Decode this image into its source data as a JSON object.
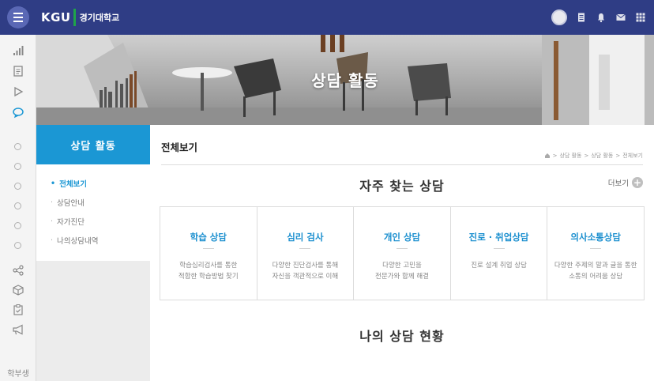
{
  "topbar": {
    "logo_text": "KGU",
    "university_name": "경기대학교",
    "icons": [
      "profile-avatar",
      "document-icon",
      "bell-icon",
      "mail-icon",
      "grid-icon"
    ]
  },
  "rail": {
    "icons": [
      "signal-icon",
      "document-icon",
      "play-icon",
      "chat-icon",
      "circle",
      "circle",
      "circle",
      "circle",
      "circle",
      "circle",
      "share-icon",
      "cube-icon",
      "clipboard-icon",
      "megaphone-icon"
    ],
    "bottom_label": "학부생"
  },
  "hero": {
    "title": "상담 활동"
  },
  "sidemenu": {
    "title": "상담 활동",
    "items": [
      {
        "label": "전체보기",
        "active": true
      },
      {
        "label": "상담안내",
        "active": false
      },
      {
        "label": "자가진단",
        "active": false
      },
      {
        "label": "나의상담내역",
        "active": false
      }
    ]
  },
  "content": {
    "page_title": "전체보기",
    "breadcrumb": [
      "상담 활동",
      "상담 활동",
      "전체보기"
    ],
    "frequent_section_title": "자주 찾는 상담",
    "more_label": "더보기",
    "cards": [
      {
        "title": "학습 상담",
        "desc": "학습심리검사를 통한\n적합한 학습방법 찾기"
      },
      {
        "title": "심리 검사",
        "desc": "다양한 진단검사를 통해\n자신을 객관적으로 이해"
      },
      {
        "title": "개인 상담",
        "desc": "다양한 고민을\n전문가와 함께 해결"
      },
      {
        "title": "진로 · 취업상담",
        "desc": "진로 설계 취업 상담"
      },
      {
        "title": "의사소통상담",
        "desc": "다양한 주제의 말과 글을 통한\n소통의 어려움 상담"
      }
    ],
    "my_status_title": "나의 상담 현황"
  },
  "colors": {
    "topbar": "#2f3d85",
    "accent_blue": "#1b97d4",
    "logo_green": "#1fa34a"
  }
}
